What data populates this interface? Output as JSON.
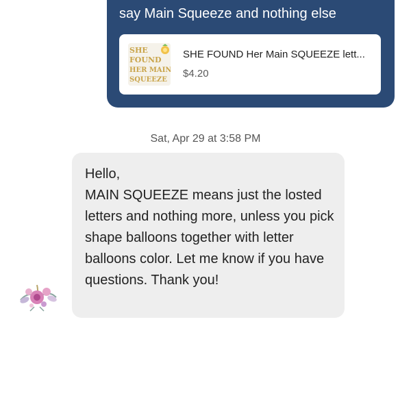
{
  "conversation": {
    "sent_message": {
      "text": "say Main Squeeze and nothing else",
      "attachment": {
        "title": "SHE FOUND Her Main SQUEEZE lett...",
        "price": "$4.20",
        "thumbnail_text": [
          "SHE",
          "FOUND",
          "HER MAIN",
          "SQUEEZE"
        ]
      }
    },
    "timestamp": "Sat, Apr 29 at 3:58 PM",
    "received_message": {
      "text": "Hello,\nMAIN SQUEEZE means just the losted letters and nothing more, unless you pick shape balloons together with letter balloons color. Let me know if you have questions. Thank you!"
    }
  },
  "colors": {
    "sent_bubble": "#2b4a75",
    "received_bubble": "#eeeeee"
  },
  "icons": {
    "avatar": "floral-avatar-icon"
  }
}
